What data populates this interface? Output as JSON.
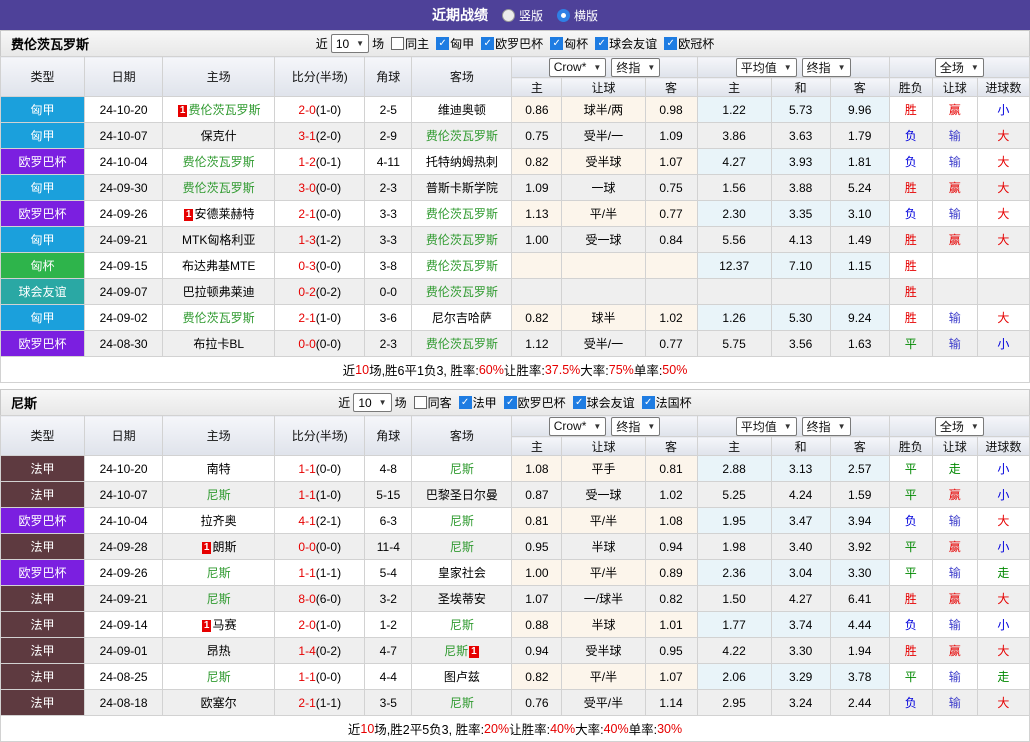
{
  "title_bar": {
    "title": "近期战绩",
    "vertical_label": "竖版",
    "horizontal_label": "横版",
    "selected": "横版"
  },
  "filter_labels": {
    "near": "近",
    "games": "场"
  },
  "columns": {
    "left": [
      "类型",
      "日期",
      "主场",
      "比分(半场)",
      "角球",
      "客场"
    ],
    "sub": [
      "主",
      "让球",
      "客",
      "主",
      "和",
      "客",
      "胜负",
      "让球",
      "进球数"
    ],
    "dropdowns": {
      "crow": "Crow*",
      "crow_final": "终指",
      "avg": "平均值",
      "avg_final": "终指",
      "scope": "全场"
    }
  },
  "colors": {
    "titlebar": "#4e4199",
    "focus_team": "#2f9a2f",
    "score": "#e60000",
    "badge": "#e60000",
    "crow_col_bg": "#fcf5eb",
    "avg_col_bg": "#e9f4f9",
    "comp": {
      "匈甲": "#1ba0dc",
      "欧罗巴杯": "#7b1fe0",
      "匈杯": "#2eb44b",
      "球会友谊": "#2aa8a4",
      "法甲": "#5e3a40"
    },
    "result": {
      "胜": "#e60000",
      "负": "#0000dd",
      "平": "#008800",
      "赢": "#e60000",
      "输": "#4040cc",
      "走": "#008800",
      "大": "#e60000",
      "小": "#0000dd"
    }
  },
  "sections": [
    {
      "team": "费伦茨瓦罗斯",
      "near_count": "10",
      "same_label": "同主",
      "same_checked": false,
      "comps": [
        "匈甲",
        "欧罗巴杯",
        "匈杯",
        "球会友谊",
        "欧冠杯"
      ],
      "rows": [
        {
          "comp": "匈甲",
          "date": "24-10-20",
          "home": "费伦茨瓦罗斯",
          "home_focus": true,
          "home_badge": "1",
          "score": "2-0",
          "half": "(1-0)",
          "corner": "2-5",
          "away": "维迪奥顿",
          "away_focus": false,
          "crow": [
            "0.86",
            "球半/两",
            "0.98"
          ],
          "avg": [
            "1.22",
            "5.73",
            "9.96"
          ],
          "result": [
            "胜",
            "赢",
            "小"
          ]
        },
        {
          "comp": "匈甲",
          "date": "24-10-07",
          "home": "保克什",
          "home_focus": false,
          "score": "3-1",
          "half": "(2-0)",
          "corner": "2-9",
          "away": "费伦茨瓦罗斯",
          "away_focus": true,
          "crow": [
            "0.75",
            "受半/一",
            "1.09"
          ],
          "avg": [
            "3.86",
            "3.63",
            "1.79"
          ],
          "result": [
            "负",
            "输",
            "大"
          ]
        },
        {
          "comp": "欧罗巴杯",
          "date": "24-10-04",
          "home": "费伦茨瓦罗斯",
          "home_focus": true,
          "score": "1-2",
          "half": "(0-1)",
          "corner": "4-11",
          "away": "托特纳姆热刺",
          "away_focus": false,
          "crow": [
            "0.82",
            "受半球",
            "1.07"
          ],
          "avg": [
            "4.27",
            "3.93",
            "1.81"
          ],
          "result": [
            "负",
            "输",
            "大"
          ]
        },
        {
          "comp": "匈甲",
          "date": "24-09-30",
          "home": "费伦茨瓦罗斯",
          "home_focus": true,
          "score": "3-0",
          "half": "(0-0)",
          "corner": "2-3",
          "away": "普斯卡斯学院",
          "away_focus": false,
          "crow": [
            "1.09",
            "一球",
            "0.75"
          ],
          "avg": [
            "1.56",
            "3.88",
            "5.24"
          ],
          "result": [
            "胜",
            "赢",
            "大"
          ]
        },
        {
          "comp": "欧罗巴杯",
          "date": "24-09-26",
          "home": "安德莱赫特",
          "home_focus": false,
          "home_badge": "1",
          "score": "2-1",
          "half": "(0-0)",
          "corner": "3-3",
          "away": "费伦茨瓦罗斯",
          "away_focus": true,
          "crow": [
            "1.13",
            "平/半",
            "0.77"
          ],
          "avg": [
            "2.30",
            "3.35",
            "3.10"
          ],
          "result": [
            "负",
            "输",
            "大"
          ]
        },
        {
          "comp": "匈甲",
          "date": "24-09-21",
          "home": "MTK匈格利亚",
          "home_focus": false,
          "score": "1-3",
          "half": "(1-2)",
          "corner": "3-3",
          "away": "费伦茨瓦罗斯",
          "away_focus": true,
          "crow": [
            "1.00",
            "受一球",
            "0.84"
          ],
          "avg": [
            "5.56",
            "4.13",
            "1.49"
          ],
          "result": [
            "胜",
            "赢",
            "大"
          ]
        },
        {
          "comp": "匈杯",
          "date": "24-09-15",
          "home": "布达弗基MTE",
          "home_focus": false,
          "score": "0-3",
          "half": "(0-0)",
          "corner": "3-8",
          "away": "费伦茨瓦罗斯",
          "away_focus": true,
          "crow": [
            "",
            "",
            ""
          ],
          "avg": [
            "12.37",
            "7.10",
            "1.15"
          ],
          "result": [
            "胜",
            "",
            ""
          ]
        },
        {
          "comp": "球会友谊",
          "date": "24-09-07",
          "home": "巴拉顿弗莱迪",
          "home_focus": false,
          "score": "0-2",
          "half": "(0-2)",
          "corner": "0-0",
          "away": "费伦茨瓦罗斯",
          "away_focus": true,
          "crow": [
            "",
            "",
            ""
          ],
          "avg": [
            "",
            "",
            ""
          ],
          "result": [
            "胜",
            "",
            ""
          ]
        },
        {
          "comp": "匈甲",
          "date": "24-09-02",
          "home": "费伦茨瓦罗斯",
          "home_focus": true,
          "score": "2-1",
          "half": "(1-0)",
          "corner": "3-6",
          "away": "尼尔吉哈萨",
          "away_focus": false,
          "crow": [
            "0.82",
            "球半",
            "1.02"
          ],
          "avg": [
            "1.26",
            "5.30",
            "9.24"
          ],
          "result": [
            "胜",
            "输",
            "大"
          ]
        },
        {
          "comp": "欧罗巴杯",
          "date": "24-08-30",
          "home": "布拉卡BL",
          "home_focus": false,
          "score": "0-0",
          "half": "(0-0)",
          "corner": "2-3",
          "away": "费伦茨瓦罗斯",
          "away_focus": true,
          "crow": [
            "1.12",
            "受半/一",
            "0.77"
          ],
          "avg": [
            "5.75",
            "3.56",
            "1.63"
          ],
          "result": [
            "平",
            "输",
            "小"
          ]
        }
      ],
      "summary": [
        {
          "t": "近",
          "hl": false
        },
        {
          "t": "10",
          "hl": true
        },
        {
          "t": "场,胜6平1负3, 胜率:",
          "hl": false
        },
        {
          "t": "60%",
          "hl": true
        },
        {
          "t": " 让胜率:",
          "hl": false
        },
        {
          "t": "37.5%",
          "hl": true
        },
        {
          "t": " 大率:",
          "hl": false
        },
        {
          "t": "75%",
          "hl": true
        },
        {
          "t": " 单率:",
          "hl": false
        },
        {
          "t": "50%",
          "hl": true
        }
      ]
    },
    {
      "team": "尼斯",
      "near_count": "10",
      "same_label": "同客",
      "same_checked": false,
      "comps": [
        "法甲",
        "欧罗巴杯",
        "球会友谊",
        "法国杯"
      ],
      "rows": [
        {
          "comp": "法甲",
          "date": "24-10-20",
          "home": "南特",
          "home_focus": false,
          "score": "1-1",
          "half": "(0-0)",
          "corner": "4-8",
          "away": "尼斯",
          "away_focus": true,
          "crow": [
            "1.08",
            "平手",
            "0.81"
          ],
          "avg": [
            "2.88",
            "3.13",
            "2.57"
          ],
          "result": [
            "平",
            "走",
            "小"
          ]
        },
        {
          "comp": "法甲",
          "date": "24-10-07",
          "home": "尼斯",
          "home_focus": true,
          "score": "1-1",
          "half": "(1-0)",
          "corner": "5-15",
          "away": "巴黎圣日尔曼",
          "away_focus": false,
          "crow": [
            "0.87",
            "受一球",
            "1.02"
          ],
          "avg": [
            "5.25",
            "4.24",
            "1.59"
          ],
          "result": [
            "平",
            "赢",
            "小"
          ]
        },
        {
          "comp": "欧罗巴杯",
          "date": "24-10-04",
          "home": "拉齐奥",
          "home_focus": false,
          "score": "4-1",
          "half": "(2-1)",
          "corner": "6-3",
          "away": "尼斯",
          "away_focus": true,
          "crow": [
            "0.81",
            "平/半",
            "1.08"
          ],
          "avg": [
            "1.95",
            "3.47",
            "3.94"
          ],
          "result": [
            "负",
            "输",
            "大"
          ]
        },
        {
          "comp": "法甲",
          "date": "24-09-28",
          "home": "朗斯",
          "home_focus": false,
          "home_badge": "1",
          "score": "0-0",
          "half": "(0-0)",
          "corner": "11-4",
          "away": "尼斯",
          "away_focus": true,
          "crow": [
            "0.95",
            "半球",
            "0.94"
          ],
          "avg": [
            "1.98",
            "3.40",
            "3.92"
          ],
          "result": [
            "平",
            "赢",
            "小"
          ]
        },
        {
          "comp": "欧罗巴杯",
          "date": "24-09-26",
          "home": "尼斯",
          "home_focus": true,
          "score": "1-1",
          "half": "(1-1)",
          "corner": "5-4",
          "away": "皇家社会",
          "away_focus": false,
          "crow": [
            "1.00",
            "平/半",
            "0.89"
          ],
          "avg": [
            "2.36",
            "3.04",
            "3.30"
          ],
          "result": [
            "平",
            "输",
            "走"
          ]
        },
        {
          "comp": "法甲",
          "date": "24-09-21",
          "home": "尼斯",
          "home_focus": true,
          "score": "8-0",
          "half": "(6-0)",
          "corner": "3-2",
          "away": "圣埃蒂安",
          "away_focus": false,
          "crow": [
            "1.07",
            "一/球半",
            "0.82"
          ],
          "avg": [
            "1.50",
            "4.27",
            "6.41"
          ],
          "result": [
            "胜",
            "赢",
            "大"
          ]
        },
        {
          "comp": "法甲",
          "date": "24-09-14",
          "home": "马赛",
          "home_focus": false,
          "home_badge": "1",
          "score": "2-0",
          "half": "(1-0)",
          "corner": "1-2",
          "away": "尼斯",
          "away_focus": true,
          "crow": [
            "0.88",
            "半球",
            "1.01"
          ],
          "avg": [
            "1.77",
            "3.74",
            "4.44"
          ],
          "result": [
            "负",
            "输",
            "小"
          ]
        },
        {
          "comp": "法甲",
          "date": "24-09-01",
          "home": "昂热",
          "home_focus": false,
          "score": "1-4",
          "half": "(0-2)",
          "corner": "4-7",
          "away": "尼斯",
          "away_focus": true,
          "away_badge": "1",
          "crow": [
            "0.94",
            "受半球",
            "0.95"
          ],
          "avg": [
            "4.22",
            "3.30",
            "1.94"
          ],
          "result": [
            "胜",
            "赢",
            "大"
          ]
        },
        {
          "comp": "法甲",
          "date": "24-08-25",
          "home": "尼斯",
          "home_focus": true,
          "score": "1-1",
          "half": "(0-0)",
          "corner": "4-4",
          "away": "图卢兹",
          "away_focus": false,
          "crow": [
            "0.82",
            "平/半",
            "1.07"
          ],
          "avg": [
            "2.06",
            "3.29",
            "3.78"
          ],
          "result": [
            "平",
            "输",
            "走"
          ]
        },
        {
          "comp": "法甲",
          "date": "24-08-18",
          "home": "欧塞尔",
          "home_focus": false,
          "score": "2-1",
          "half": "(1-1)",
          "corner": "3-5",
          "away": "尼斯",
          "away_focus": true,
          "crow": [
            "0.76",
            "受平/半",
            "1.14"
          ],
          "avg": [
            "2.95",
            "3.24",
            "2.44"
          ],
          "result": [
            "负",
            "输",
            "大"
          ]
        }
      ],
      "summary": [
        {
          "t": "近",
          "hl": false
        },
        {
          "t": "10",
          "hl": true
        },
        {
          "t": "场,胜2平5负3, 胜率:",
          "hl": false
        },
        {
          "t": "20%",
          "hl": true
        },
        {
          "t": " 让胜率:",
          "hl": false
        },
        {
          "t": "40%",
          "hl": true
        },
        {
          "t": " 大率:",
          "hl": false
        },
        {
          "t": "40%",
          "hl": true
        },
        {
          "t": " 单率:",
          "hl": false
        },
        {
          "t": "30%",
          "hl": true
        }
      ]
    }
  ]
}
